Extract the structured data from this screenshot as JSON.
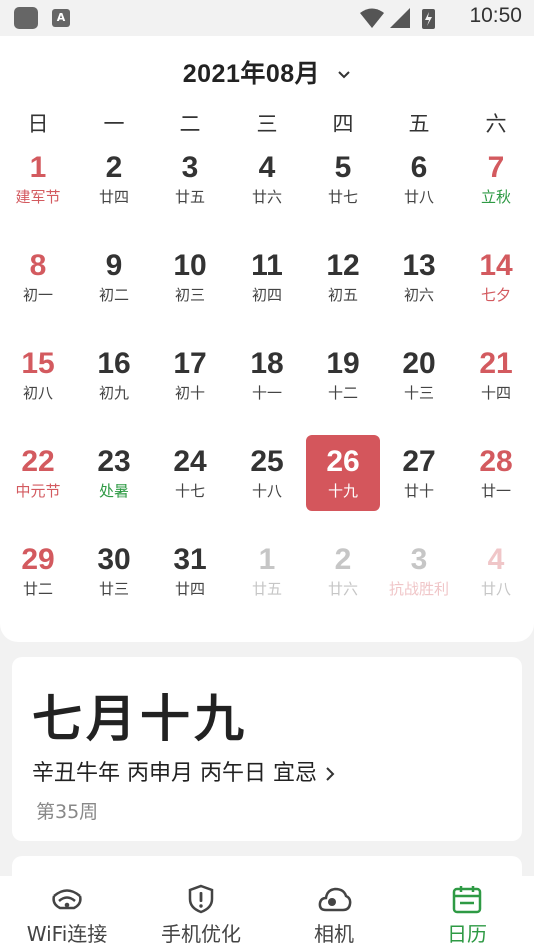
{
  "status_bar": {
    "time": "10:50",
    "notification_letter": "A"
  },
  "calendar": {
    "month_title": "2021年08月",
    "weekdays": [
      "日",
      "一",
      "二",
      "三",
      "四",
      "五",
      "六"
    ],
    "days": [
      {
        "num": "1",
        "lunar": "建军节",
        "red": true,
        "lunar_color": "red"
      },
      {
        "num": "2",
        "lunar": "廿四"
      },
      {
        "num": "3",
        "lunar": "廿五"
      },
      {
        "num": "4",
        "lunar": "廿六"
      },
      {
        "num": "5",
        "lunar": "廿七"
      },
      {
        "num": "6",
        "lunar": "廿八"
      },
      {
        "num": "7",
        "lunar": "立秋",
        "red": true,
        "lunar_color": "green"
      },
      {
        "num": "8",
        "lunar": "初一",
        "red": true
      },
      {
        "num": "9",
        "lunar": "初二"
      },
      {
        "num": "10",
        "lunar": "初三"
      },
      {
        "num": "11",
        "lunar": "初四"
      },
      {
        "num": "12",
        "lunar": "初五"
      },
      {
        "num": "13",
        "lunar": "初六"
      },
      {
        "num": "14",
        "lunar": "七夕",
        "red": true,
        "lunar_color": "red"
      },
      {
        "num": "15",
        "lunar": "初八",
        "red": true
      },
      {
        "num": "16",
        "lunar": "初九"
      },
      {
        "num": "17",
        "lunar": "初十"
      },
      {
        "num": "18",
        "lunar": "十一"
      },
      {
        "num": "19",
        "lunar": "十二"
      },
      {
        "num": "20",
        "lunar": "十三"
      },
      {
        "num": "21",
        "lunar": "十四",
        "red": true
      },
      {
        "num": "22",
        "lunar": "中元节",
        "red": true,
        "lunar_color": "red"
      },
      {
        "num": "23",
        "lunar": "处暑",
        "lunar_color": "green"
      },
      {
        "num": "24",
        "lunar": "十七"
      },
      {
        "num": "25",
        "lunar": "十八"
      },
      {
        "num": "26",
        "lunar": "十九",
        "selected": true
      },
      {
        "num": "27",
        "lunar": "廿十"
      },
      {
        "num": "28",
        "lunar": "廿一",
        "red": true
      },
      {
        "num": "29",
        "lunar": "廿二",
        "red": true
      },
      {
        "num": "30",
        "lunar": "廿三"
      },
      {
        "num": "31",
        "lunar": "廿四"
      },
      {
        "num": "1",
        "lunar": "廿五",
        "next": true
      },
      {
        "num": "2",
        "lunar": "廿六",
        "next": true
      },
      {
        "num": "3",
        "lunar": "抗战胜利",
        "next": true,
        "lunar_color": "red"
      },
      {
        "num": "4",
        "lunar": "廿八",
        "next": true,
        "red": true
      }
    ]
  },
  "lunar_info": {
    "lunar_date": "七月十九",
    "ganzhi": "辛丑牛年 丙申月  丙午日 宜忌",
    "week": "第35周"
  },
  "bottom_nav": [
    {
      "label": "WiFi连接",
      "icon": "wifi-icon"
    },
    {
      "label": "手机优化",
      "icon": "shield-icon"
    },
    {
      "label": "相机",
      "icon": "camera-icon"
    },
    {
      "label": "日历",
      "icon": "calendar-icon",
      "active": true
    }
  ],
  "colors": {
    "red": "#d35a5f",
    "green": "#2e9a44",
    "selected_bg": "#d4565c"
  }
}
